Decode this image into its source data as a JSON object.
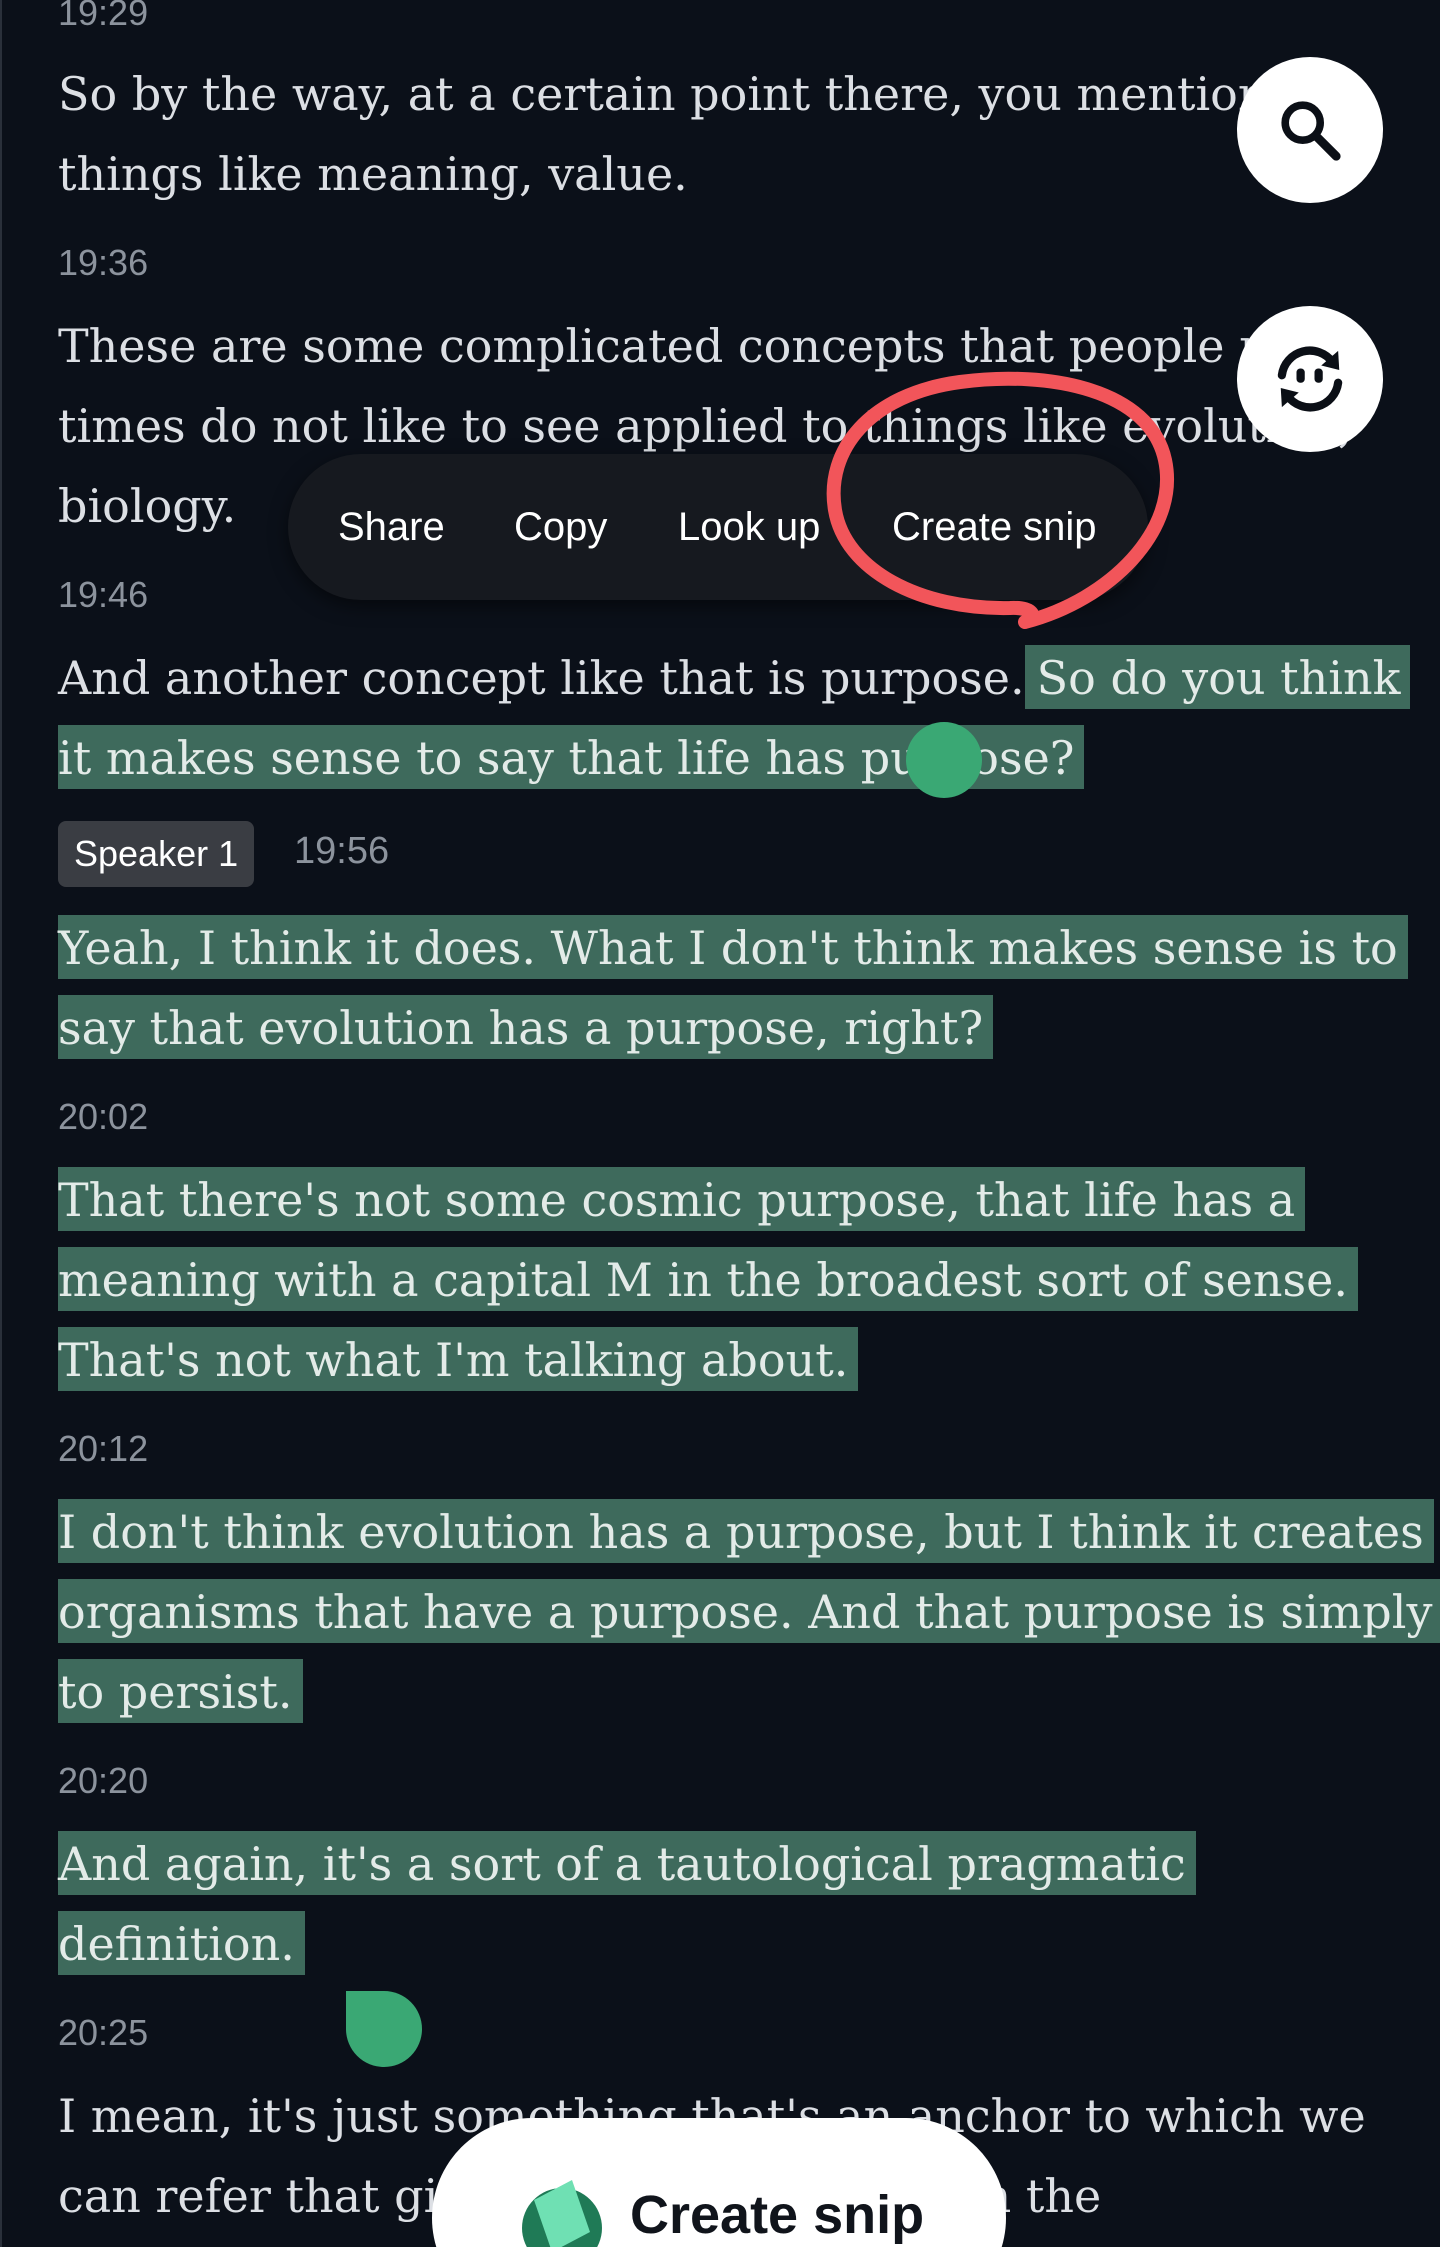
{
  "transcript": {
    "entries": [
      {
        "time": "19:29",
        "lines": [
          "So by the way, at a certain point there, you mentioned",
          "things like meaning, value."
        ]
      },
      {
        "time": "19:36",
        "lines": [
          "These are some complicated concepts that people many",
          "times do not like to see applied to things like evolution,",
          "biology."
        ]
      },
      {
        "time": "19:46",
        "line_plain": "And another concept like that is purpose.",
        "line_hl_part": "So do you think",
        "line2": "it makes sense to say that life has purpose?"
      },
      {
        "speaker": "Speaker 1",
        "time": "19:56",
        "lines": [
          "Yeah, I think it does. What I don't think makes sense is to",
          "say that evolution has a purpose, right?"
        ]
      },
      {
        "time": "20:02",
        "lines": [
          "That there's not some cosmic purpose, that life has a",
          "meaning with a capital M in the broadest sort of sense.",
          "That's not what I'm talking about."
        ]
      },
      {
        "time": "20:12",
        "lines": [
          "I don't think evolution has a purpose, but I think it creates",
          "organisms that have a purpose. And that purpose is simply",
          "to persist."
        ]
      },
      {
        "time": "20:20",
        "lines": [
          "And again, it's a sort of a tautological pragmatic",
          "definition."
        ]
      },
      {
        "time": "20:25",
        "lines": [
          "I mean, it's just something that's an anchor to which we",
          "can refer that gives meaning to things in the"
        ]
      }
    ]
  },
  "context_menu": {
    "share": "Share",
    "copy": "Copy",
    "look_up": "Look up",
    "create_snip": "Create snip"
  },
  "buttons": {
    "search_icon": "search-icon",
    "sync_icon": "sync-quote-icon"
  },
  "snip_button": {
    "label": "Create snip"
  },
  "colors": {
    "background": "#0b1019",
    "highlight": "#3e6a5c",
    "handle": "#3aa874",
    "annotation": "#f2555a"
  }
}
